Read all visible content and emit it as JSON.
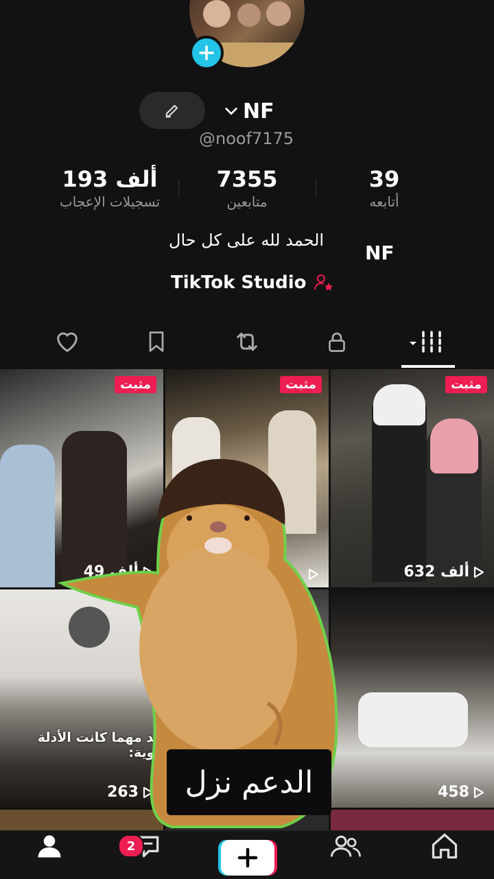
{
  "profile": {
    "display_name": "NF",
    "handle": "@noof7175",
    "bio": "الحمد لله على كل حال",
    "bio_name": "NF",
    "studio_label": "TikTok Studio"
  },
  "stats": {
    "likes_value": "193 ألف",
    "likes_label": "تسجيلات الإعجاب",
    "followers_value": "7355",
    "followers_label": "متابعين",
    "following_value": "39",
    "following_label": "أتابعه"
  },
  "tabs": [
    {
      "icon": "heart-icon"
    },
    {
      "icon": "bookmark-icon"
    },
    {
      "icon": "repost-icon"
    },
    {
      "icon": "lock-icon"
    },
    {
      "icon": "grid-icon",
      "active": true
    }
  ],
  "videos": [
    {
      "pinned": "مثبت",
      "views": "49 ألف"
    },
    {
      "pinned": "مثبت",
      "views": ""
    },
    {
      "pinned": "مثبت",
      "views": "632 ألف"
    },
    {
      "caption": "جد مهما كانت الأدلة قوية:",
      "views": "263"
    },
    {
      "views": ""
    },
    {
      "views": "458"
    }
  ],
  "overlay": {
    "support_text": "الدعم نزل"
  },
  "bottom_nav": {
    "inbox_badge": "2"
  },
  "colors": {
    "accent_cyan": "#23c4e8",
    "accent_red": "#ee1d52",
    "background": "#121212"
  }
}
